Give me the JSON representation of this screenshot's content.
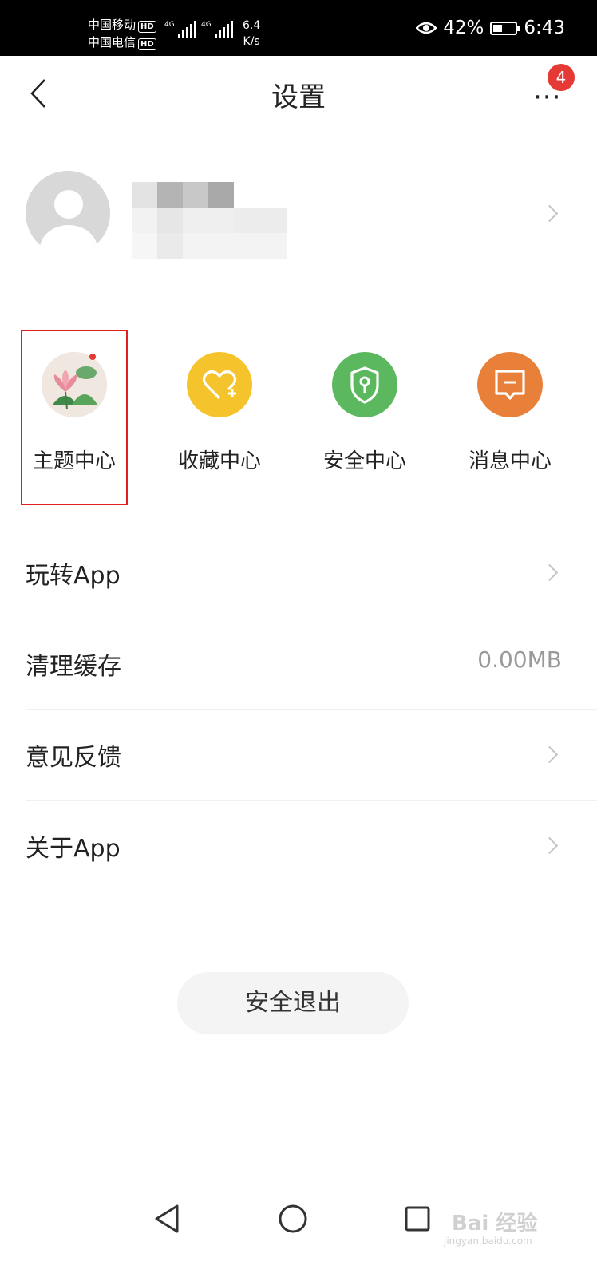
{
  "status_bar": {
    "carrier_1": "中国移动",
    "carrier_2": "中国电信",
    "hd": "HD",
    "network": "4G",
    "speed_value": "6.4",
    "speed_unit": "K/s",
    "battery_percent": "42%",
    "battery_level": 0.42,
    "time": "6:43"
  },
  "header": {
    "title": "设置",
    "more_badge": "4"
  },
  "quick_actions": [
    {
      "label": "主题中心",
      "color": "#e8ded6"
    },
    {
      "label": "收藏中心",
      "color": "#f5c32c"
    },
    {
      "label": "安全中心",
      "color": "#5bb85e"
    },
    {
      "label": "消息中心",
      "color": "#e8803a"
    }
  ],
  "menu": {
    "play_app": "玩转App",
    "clear_cache": "清理缓存",
    "cache_size": "0.00MB",
    "feedback": "意见反馈",
    "about_app": "关于App"
  },
  "logout_label": "安全退出",
  "watermark": {
    "text": "Bai 经验",
    "url": "jingyan.baidu.com"
  },
  "colors": {
    "accent_red": "#e53935",
    "highlight_box": "#e02020"
  }
}
